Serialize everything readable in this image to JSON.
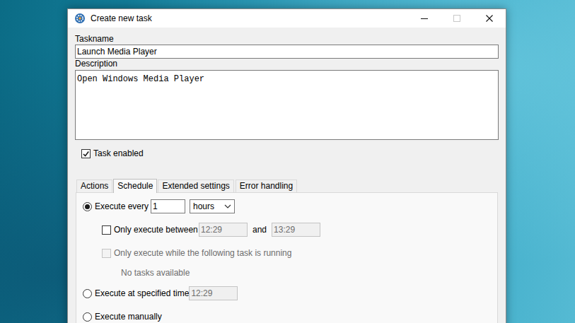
{
  "window": {
    "title": "Create new task",
    "controls": [
      {
        "kind": "minimize",
        "disabled": false
      },
      {
        "kind": "maximize",
        "disabled": true
      },
      {
        "kind": "close",
        "disabled": false
      }
    ]
  },
  "taskname": {
    "label": "Taskname",
    "value": "Launch Media Player"
  },
  "description": {
    "label": "Description",
    "value": "Open Windows Media Player"
  },
  "task_enabled": {
    "label": "Task enabled",
    "checked": true
  },
  "tabs": [
    {
      "label": "Actions",
      "selected": false
    },
    {
      "label": "Schedule",
      "selected": true
    },
    {
      "label": "Extended settings",
      "selected": false
    },
    {
      "label": "Error handling",
      "selected": false
    }
  ],
  "schedule": {
    "execute_every": {
      "label": "Execute every",
      "selected": true,
      "value": "1",
      "unit": "hours"
    },
    "only_between": {
      "label": "Only execute between",
      "checked": false,
      "from": "12:29",
      "joiner": "and",
      "to": "13:29",
      "times_disabled": true
    },
    "only_while": {
      "label": "Only execute while the following task is running",
      "checked": false,
      "disabled": true,
      "note": "No tasks available"
    },
    "specified_time": {
      "label": "Execute at specified time",
      "selected": false,
      "value": "12:29",
      "value_disabled": true
    },
    "manually": {
      "label": "Execute manually",
      "selected": false
    }
  }
}
